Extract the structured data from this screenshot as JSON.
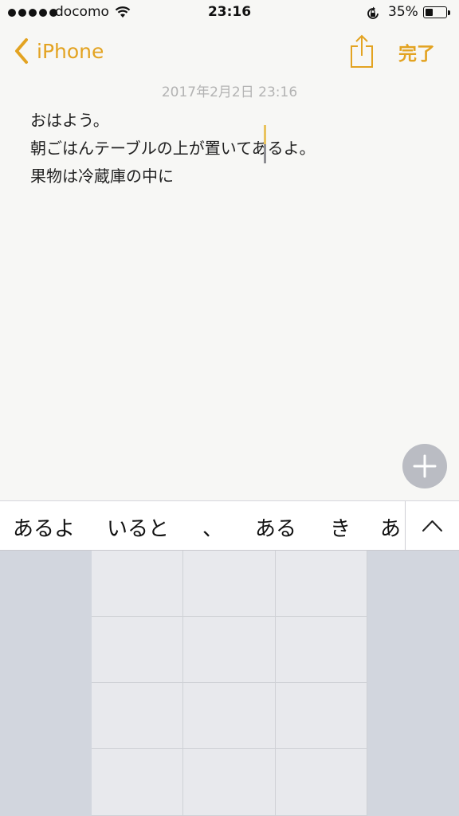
{
  "status_bar": {
    "carrier": "docomo",
    "time": "23:16",
    "battery": "35%",
    "battery_level": 0.35
  },
  "nav": {
    "back_label": "iPhone",
    "done_label": "完了",
    "accent_color": "#e3a321"
  },
  "note": {
    "date": "2017年2月2日 23:16",
    "lines": [
      "おはよう。",
      "朝ごはんテーブルの上が置いてあるよ。",
      "果物は冷蔵庫の中に"
    ]
  },
  "suggestions": [
    "あるよ",
    "いると",
    "、",
    "ある",
    "き",
    "あ"
  ],
  "icons": {
    "back": "chevron-left-icon",
    "share": "share-icon",
    "add": "plus-icon",
    "expand": "chevron-up-icon"
  }
}
